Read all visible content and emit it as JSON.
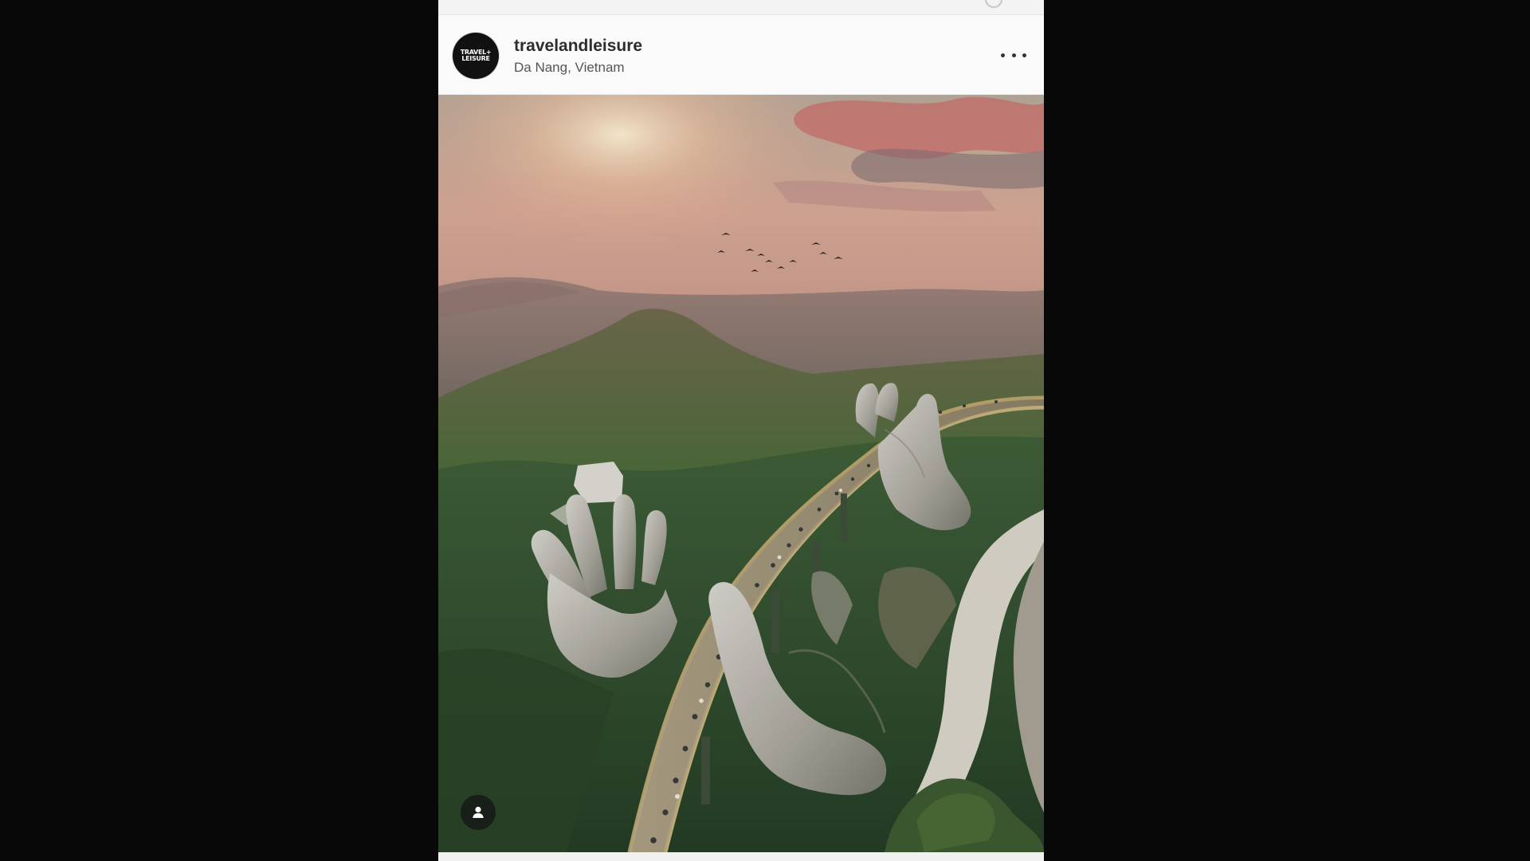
{
  "post": {
    "username": "travelandleisure",
    "location": "Da Nang, Vietnam",
    "avatar": {
      "line1": "TRAVEL+",
      "line2": "LEISURE",
      "background": "#111111"
    },
    "more_icon": "more-horizontal-icon",
    "tag_icon": "user-tag-icon"
  },
  "colors": {
    "page_background": "#080808",
    "card_background": "#f6f6f6",
    "username_text": "#2d2d2d",
    "location_text": "#555555"
  }
}
